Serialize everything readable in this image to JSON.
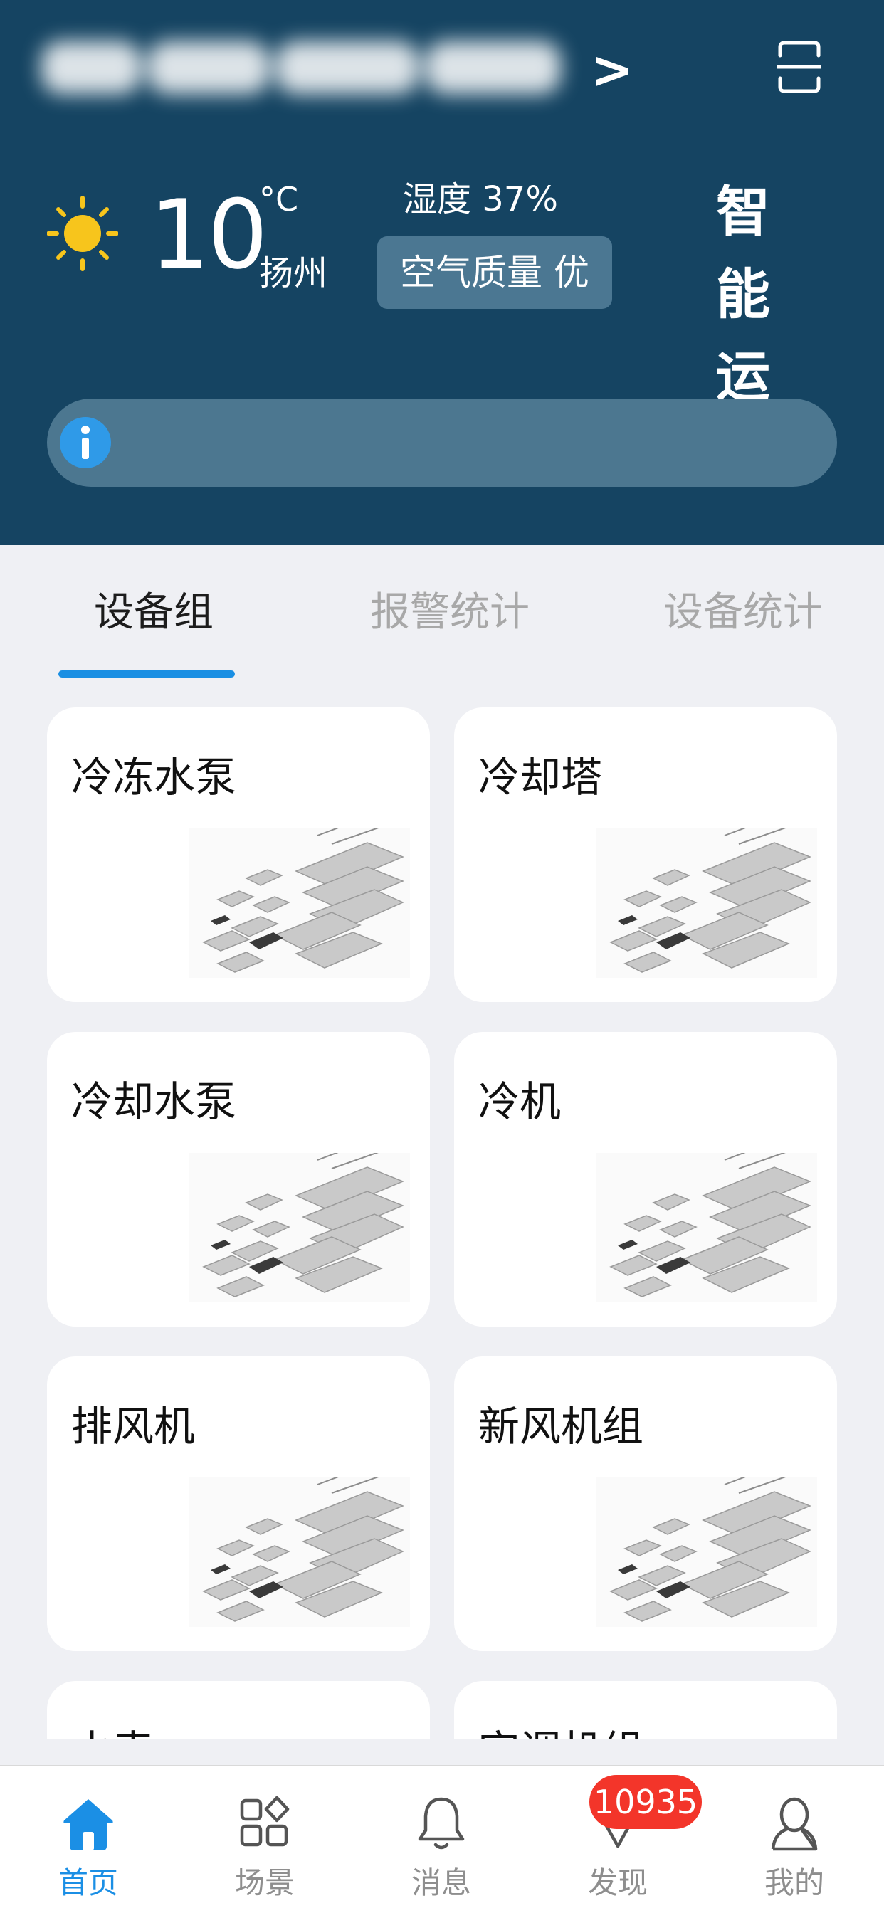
{
  "header": {
    "project_arrow": ">",
    "weather": {
      "icon": "sun-icon",
      "temperature": "10",
      "unit": "°C",
      "city": "扬州",
      "humidity": "湿度 37%",
      "air_quality": "空气质量 优"
    },
    "brand_line1": "智能",
    "brand_line2": "运维",
    "notice_icon": "info-icon",
    "colors": {
      "header_bg": "#154462",
      "accent": "#1a8fe3",
      "badge": "#f3352a"
    }
  },
  "tabs": [
    {
      "label": "设备组",
      "active": true
    },
    {
      "label": "报警统计",
      "active": false
    },
    {
      "label": "设备统计",
      "active": false
    }
  ],
  "device_groups": [
    {
      "title": "冷冻水泵"
    },
    {
      "title": "冷却塔"
    },
    {
      "title": "冷却水泵"
    },
    {
      "title": "冷机"
    },
    {
      "title": "排风机"
    },
    {
      "title": "新风机组"
    },
    {
      "title": "水表"
    },
    {
      "title": "空调机组"
    }
  ],
  "bottom_nav": [
    {
      "label": "首页",
      "icon": "home-icon",
      "active": true
    },
    {
      "label": "场景",
      "icon": "grid-icon",
      "active": false
    },
    {
      "label": "消息",
      "icon": "bell-icon",
      "active": false
    },
    {
      "label": "发现",
      "icon": "discover-icon",
      "active": false,
      "badge": "10935"
    },
    {
      "label": "我的",
      "icon": "user-icon",
      "active": false
    }
  ]
}
